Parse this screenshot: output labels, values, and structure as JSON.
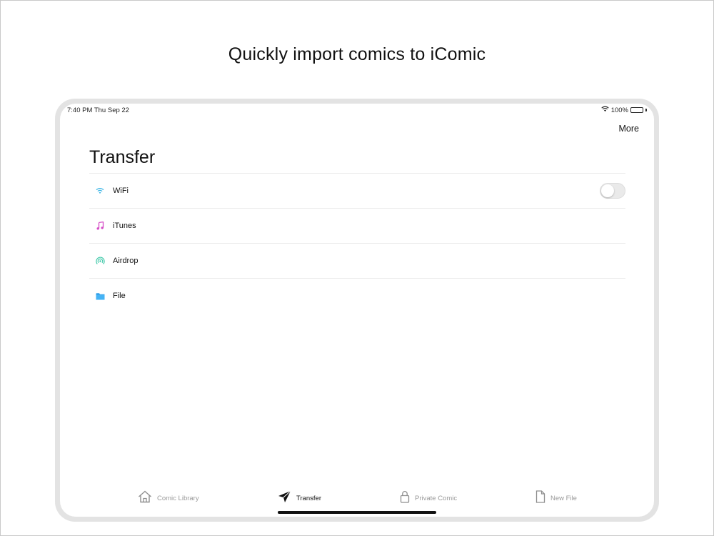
{
  "headline": "Quickly import comics to iComic",
  "status_bar": {
    "time": "7:40 PM   Thu Sep 22",
    "battery": "100%"
  },
  "nav": {
    "more_label": "More"
  },
  "page_title": "Transfer",
  "rows": [
    {
      "label": "WiFi",
      "icon": "wifi-icon",
      "toggle_on": false
    },
    {
      "label": "iTunes",
      "icon": "music-note-icon"
    },
    {
      "label": "Airdrop",
      "icon": "airdrop-icon"
    },
    {
      "label": "File",
      "icon": "folder-icon"
    }
  ],
  "tabs": [
    {
      "label": "Comic Library",
      "icon": "house-icon",
      "active": false
    },
    {
      "label": "Transfer",
      "icon": "paper-plane-icon",
      "active": true
    },
    {
      "label": "Private Comic",
      "icon": "lock-icon",
      "active": false
    },
    {
      "label": "New File",
      "icon": "document-icon",
      "active": false
    }
  ],
  "colors": {
    "wifi": "#3fb6e6",
    "itunes": "#d54cc6",
    "airdrop": "#3cc7a7",
    "folder": "#2f9ee8",
    "inactive_tab": "#9a9a9a",
    "active_tab": "#111111"
  }
}
